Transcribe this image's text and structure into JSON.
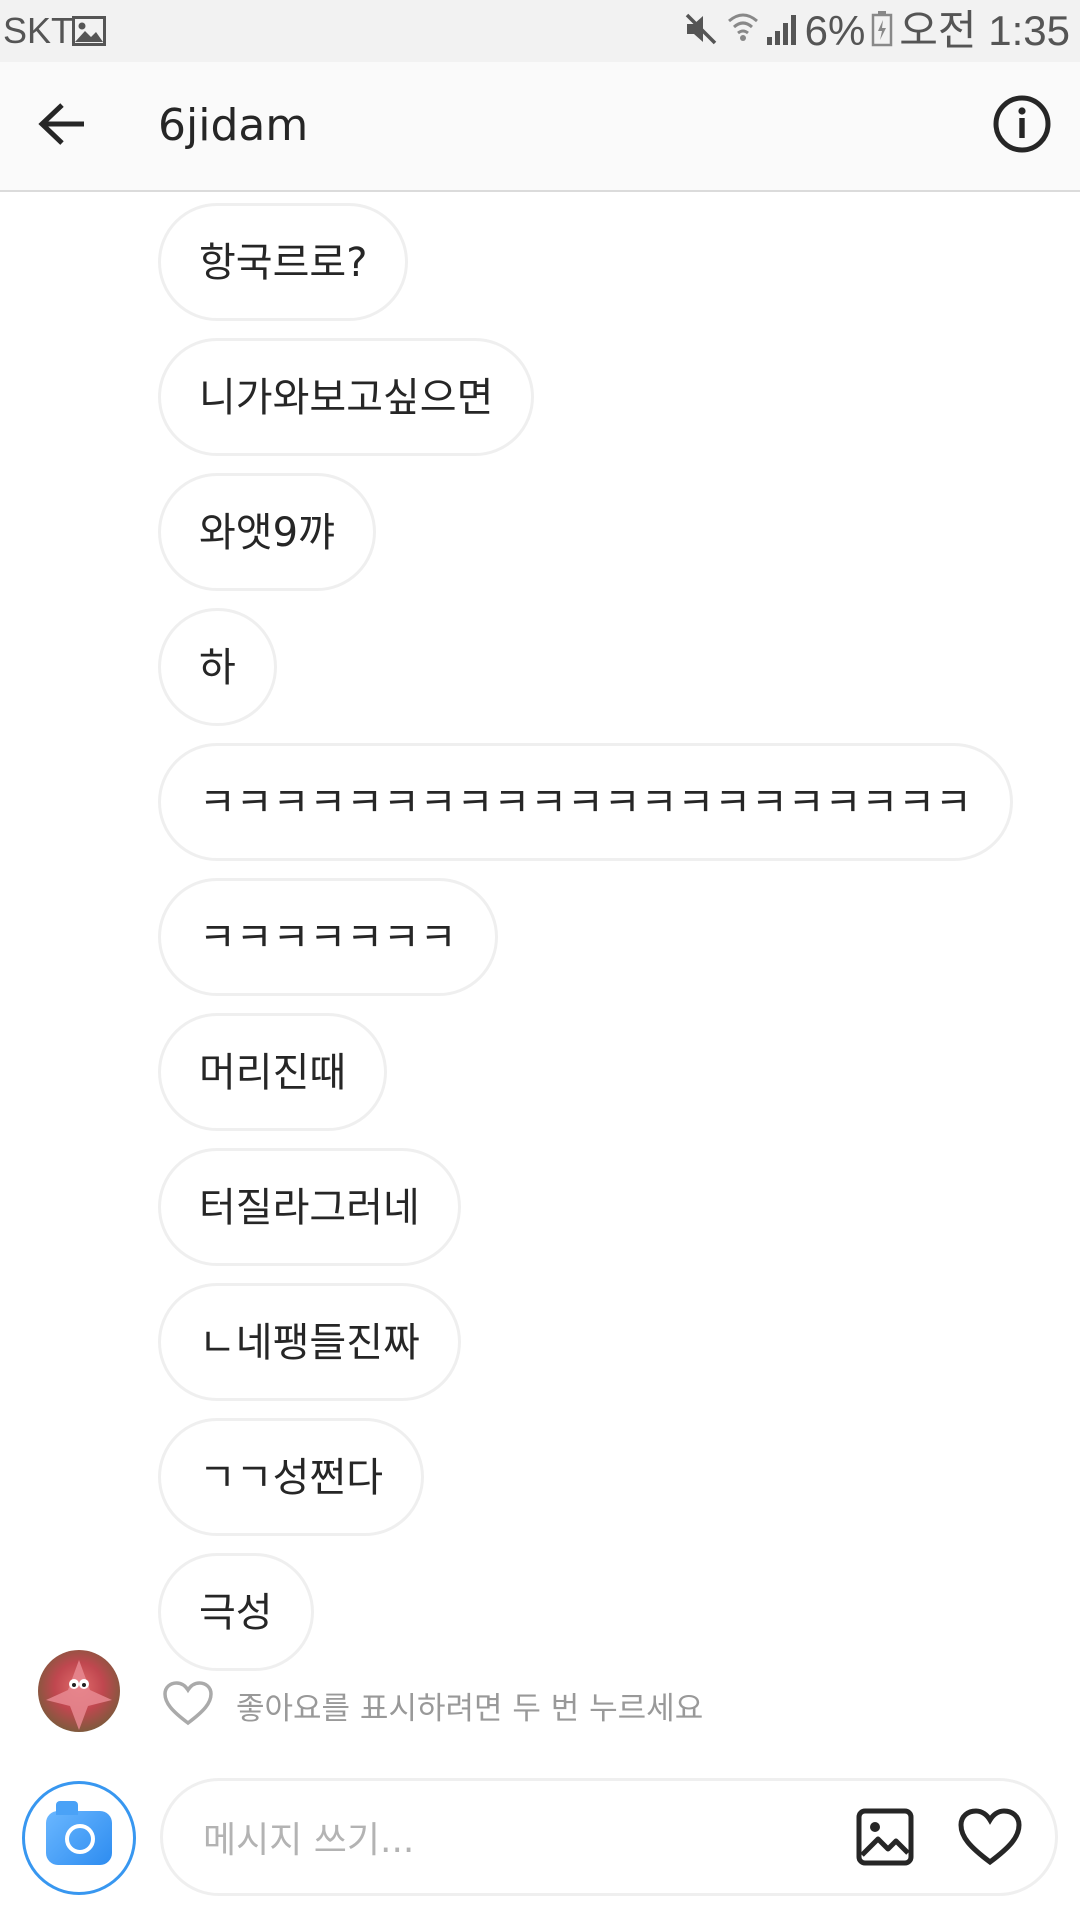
{
  "status_bar": {
    "carrier": "SKT",
    "battery": "6%",
    "time": "오전 1:35",
    "icons": [
      "gallery-icon",
      "mute-icon",
      "wifi-icon",
      "signal-icon",
      "battery-icon"
    ]
  },
  "header": {
    "title": "6jidam",
    "icons": [
      "back-arrow-icon",
      "info-icon"
    ]
  },
  "messages": [
    {
      "text": "항국르로?"
    },
    {
      "text": "니가와보고싶으면"
    },
    {
      "text": "와앳9꺄"
    },
    {
      "text": "하"
    },
    {
      "text": "ㅋㅋㅋㅋㅋㅋㅋㅋㅋㅋㅋㅋㅋㅋㅋㅋㅋㅋㅋㅋㅋ"
    },
    {
      "text": "ㅋㅋㅋㅋㅋㅋㅋ"
    },
    {
      "text": "머리진때"
    },
    {
      "text": "터질라그러네"
    },
    {
      "text": "ㄴ네팽들진짜"
    },
    {
      "text": "ㄱㄱ성쩐다"
    },
    {
      "text": "극성"
    }
  ],
  "like_hint": "좋아요를 표시하려면 두 번 누르세요",
  "composer": {
    "placeholder": "메시지 쓰기...",
    "icons": [
      "camera-icon",
      "image-icon",
      "heart-icon"
    ]
  },
  "colors": {
    "accent": "#3897f0",
    "bubble_border": "#efefef",
    "hint_text": "#999999"
  }
}
